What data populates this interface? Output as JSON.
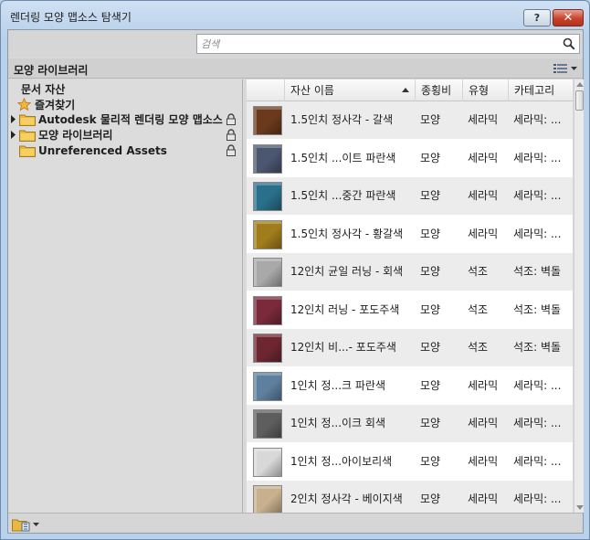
{
  "window": {
    "title": "렌더링 모양 맵소스 탐색기",
    "help_label": "?",
    "close_label": "✕"
  },
  "search": {
    "placeholder": "검색",
    "value": ""
  },
  "library_header": {
    "title": "모양 라이브러리"
  },
  "tree": {
    "document_assets": "문서 자산",
    "favorites": "즐겨찾기",
    "libraries": [
      {
        "label": "Autodesk 물리적 렌더링 모양 맵소스",
        "locked": true,
        "expandable": true
      },
      {
        "label": "모양 라이브러리",
        "locked": true,
        "expandable": true
      },
      {
        "label": "Unreferenced Assets",
        "locked": true,
        "expandable": false
      }
    ]
  },
  "table": {
    "columns": [
      "자산 이름",
      "종횡비",
      "유형",
      "카테고리"
    ],
    "sorted_column": "자산 이름",
    "rows": [
      {
        "name": "1.5인치 정사각 - 갈색",
        "aspect": "모양",
        "type": "세라믹",
        "category": "세라믹: ...",
        "swatch": "#6b3a1c"
      },
      {
        "name": "1.5인치 ...이트 파란색",
        "aspect": "모양",
        "type": "세라믹",
        "category": "세라믹: ...",
        "swatch": "#4b5670"
      },
      {
        "name": "1.5인치 ...중간 파란색",
        "aspect": "모양",
        "type": "세라믹",
        "category": "세라믹: ...",
        "swatch": "#2a6f8c"
      },
      {
        "name": "1.5인치 정사각 - 황갈색",
        "aspect": "모양",
        "type": "세라믹",
        "category": "세라믹: ...",
        "swatch": "#a17c1c"
      },
      {
        "name": "12인치 균일 러닝 - 회색",
        "aspect": "모양",
        "type": "석조",
        "category": "석조: 벽돌",
        "swatch": "#a9a9a9"
      },
      {
        "name": "12인치 러닝 - 포도주색",
        "aspect": "모양",
        "type": "석조",
        "category": "석조: 벽돌",
        "swatch": "#7a2a3a"
      },
      {
        "name": "12인치 비...- 포도주색",
        "aspect": "모양",
        "type": "석조",
        "category": "석조: 벽돌",
        "swatch": "#6e2731"
      },
      {
        "name": "1인치 정...크 파란색",
        "aspect": "모양",
        "type": "세라믹",
        "category": "세라믹: ...",
        "swatch": "#5f7f9f"
      },
      {
        "name": "1인치 정...이크 회색",
        "aspect": "모양",
        "type": "세라믹",
        "category": "세라믹: ...",
        "swatch": "#5e5e5e"
      },
      {
        "name": "1인치 정...아이보리색",
        "aspect": "모양",
        "type": "세라믹",
        "category": "세라믹: ...",
        "swatch": "#d8d8d8"
      },
      {
        "name": "2인치 정사각 - 베이지색",
        "aspect": "모양",
        "type": "세라믹",
        "category": "세라믹: ...",
        "swatch": "#c8b08e"
      }
    ]
  },
  "colors": {
    "title_bar": "#b9d1ea",
    "close_button": "#c7432a",
    "favorites_star": "#f0a020",
    "folder": "#e8b840"
  }
}
